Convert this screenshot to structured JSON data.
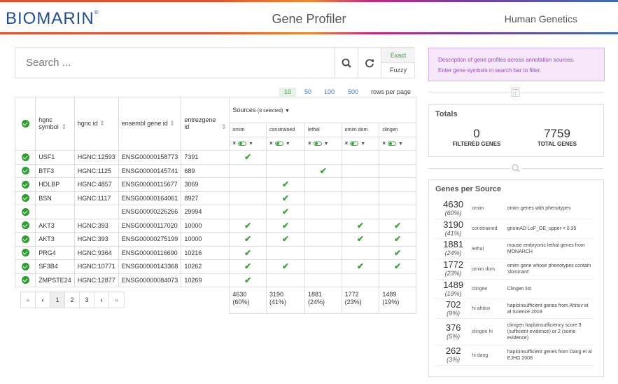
{
  "header": {
    "logo": "BIOMARIN",
    "title": "Gene Profiler",
    "right": "Human Genetics"
  },
  "search": {
    "placeholder": "Search ...",
    "exact": "Exact",
    "fuzzy": "Fuzzy"
  },
  "info": {
    "line1": "Description of gene profiles across annotation sources.",
    "line2": "Enter gene symbols in search bar to filter."
  },
  "rows_per_page": {
    "options": [
      "10",
      "50",
      "100",
      "500"
    ],
    "label": "rows per page"
  },
  "columns": {
    "hgnc_symbol": "hgnc symbol",
    "hgnc_id": "hgnc id",
    "ensembl": "ensembl gene id",
    "entrez": "entrezgene id",
    "sources": "Sources",
    "sources_count": "(8 selected)",
    "src": [
      "omim",
      "constrained",
      "lethal",
      "omim dom",
      "clingen"
    ]
  },
  "rows": [
    {
      "sym": "USF1",
      "hgnc": "HGNC:12593",
      "ens": "ENSG00000158773",
      "ent": "7391"
    },
    {
      "sym": "BTF3",
      "hgnc": "HGNC:1125",
      "ens": "ENSG00000145741",
      "ent": "689"
    },
    {
      "sym": "HDLBP",
      "hgnc": "HGNC:4857",
      "ens": "ENSG00000115677",
      "ent": "3069"
    },
    {
      "sym": "BSN",
      "hgnc": "HGNC:1117",
      "ens": "ENSG00000164061",
      "ent": "8927"
    },
    {
      "sym": "",
      "hgnc": "",
      "ens": "ENSG00000226266",
      "ent": "29994"
    },
    {
      "sym": "AKT3",
      "hgnc": "HGNC:393",
      "ens": "ENSG00000117020",
      "ent": "10000"
    },
    {
      "sym": "AKT3",
      "hgnc": "HGNC:393",
      "ens": "ENSG00000275199",
      "ent": "10000"
    },
    {
      "sym": "PRG4",
      "hgnc": "HGNC:9364",
      "ens": "ENSG00000116690",
      "ent": "10216"
    },
    {
      "sym": "SF3B4",
      "hgnc": "HGNC:10771",
      "ens": "ENSG00000143368",
      "ent": "10262"
    },
    {
      "sym": "ZMPSTE24",
      "hgnc": "HGNC:12877",
      "ens": "ENSG00000084073",
      "ent": "10269"
    }
  ],
  "totals_row": [
    "4630",
    "(60%)",
    "3190",
    "(41%)",
    "1881",
    "(24%)",
    "1772",
    "(23%)",
    "1489",
    "(19%)"
  ],
  "pager": {
    "first": "«",
    "prev": "‹",
    "p1": "1",
    "p2": "2",
    "p3": "3",
    "next": "›",
    "last": "»"
  },
  "totals": {
    "title": "Totals",
    "filtered": "0",
    "filtered_label": "FILTERED GENES",
    "total": "7759",
    "total_label": "TOTAL GENES"
  },
  "gps": {
    "title": "Genes per Source",
    "items": [
      {
        "n": "4630",
        "p": "(60%)",
        "s": "omim",
        "d": "omim genes with phenotypes"
      },
      {
        "n": "3190",
        "p": "(41%)",
        "s": "constrained",
        "d": "gnomAD LoF_OE_upper < 0.35"
      },
      {
        "n": "1881",
        "p": "(24%)",
        "s": "lethal",
        "d": "mouse embryonic lethal genes from MONARCH"
      },
      {
        "n": "1772",
        "p": "(23%)",
        "s": "omim dom",
        "d": "omim gene whose phenotypes contain 'dominant'"
      },
      {
        "n": "1489",
        "p": "(19%)",
        "s": "clingen",
        "d": "Clingen list"
      },
      {
        "n": "702",
        "p": "(9%)",
        "s": "hi ahituv",
        "d": "haploinsufficient genes from Ahituv et al Science 2018"
      },
      {
        "n": "376",
        "p": "(5%)",
        "s": "clingen hi",
        "d": "clinigen haploinsufficiency score 3 (sufficient evidence) or 2 (some evidence)"
      },
      {
        "n": "262",
        "p": "(3%)",
        "s": "hi dang",
        "d": "haploinsufficient genes from Dang et al EJHG 2008"
      }
    ]
  }
}
